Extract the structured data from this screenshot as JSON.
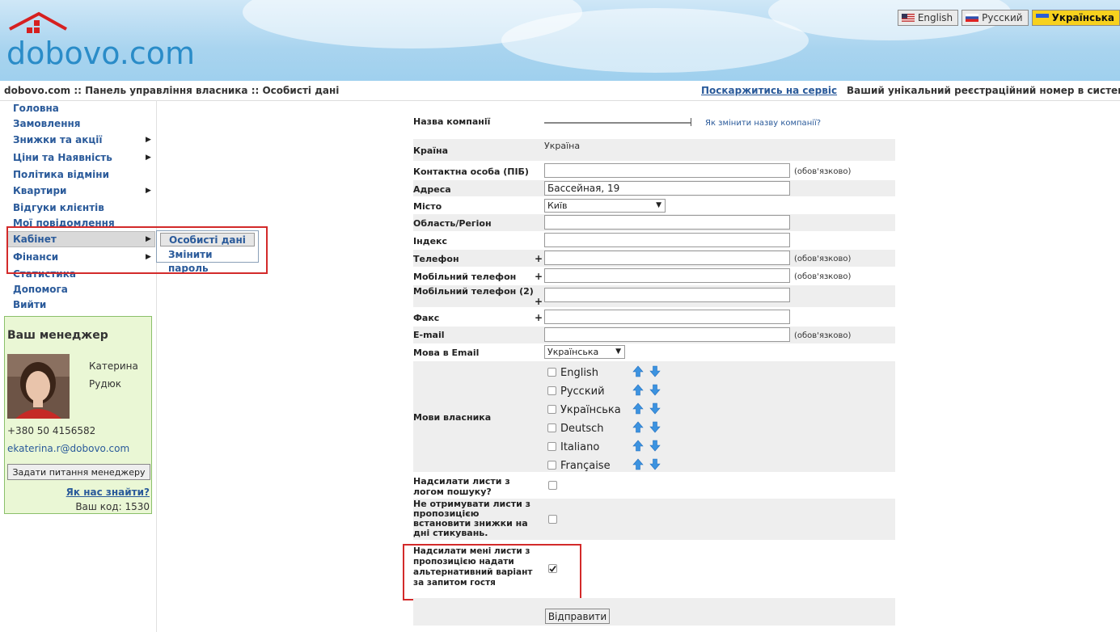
{
  "brand": {
    "logo_text": "dobovo.com",
    "logo_colors": {
      "house": "#d62020",
      "text": "#2a8cc8"
    }
  },
  "languages": [
    {
      "label": "English",
      "flag": "us-flag-icon",
      "active": false
    },
    {
      "label": "Русский",
      "flag": "ru-flag-icon",
      "active": false
    },
    {
      "label": "Українська",
      "flag": "ua-flag-icon",
      "active": true
    }
  ],
  "breadcrumb": "dobovo.com :: Панель управління власника :: Особисті дані",
  "complain_link": "Поскаржитись на сервіс",
  "registration_text": "Ваший унікальний реєстраційний номер в системі ::",
  "menu": [
    {
      "label": "Головна",
      "has_submenu": false
    },
    {
      "label": "Замовлення",
      "has_submenu": false
    },
    {
      "label": "Знижки та акції",
      "has_submenu": true
    },
    {
      "label": "Ціни та Наявність",
      "has_submenu": true
    },
    {
      "label": "Політика відміни",
      "has_submenu": false
    },
    {
      "label": "Квартири",
      "has_submenu": true
    },
    {
      "label": "Відгуки клієнтів",
      "has_submenu": false
    },
    {
      "label": "Мої повідомлення",
      "has_submenu": false
    },
    {
      "label": "Кабінет",
      "has_submenu": true
    },
    {
      "label": "Фінанси",
      "has_submenu": true
    },
    {
      "label": "Статистика",
      "has_submenu": false
    },
    {
      "label": "Допомога",
      "has_submenu": false
    },
    {
      "label": "Вийти",
      "has_submenu": false
    }
  ],
  "submenu": [
    {
      "label": "Особисті дані"
    },
    {
      "label": "Змінити пароль"
    }
  ],
  "manager": {
    "title": "Ваш менеджер",
    "first_name": "Катерина",
    "last_name": "Рудюк",
    "phone": "+380 50 4156582",
    "email": "ekaterina.r@dobovo.com",
    "ask_button": "Задати питання менеджеру",
    "find_link": "Як нас знайти?",
    "code_text": "Ваш код: 1530"
  },
  "form": {
    "company_label": "Назва компанії",
    "company_change_link": "Як змінити назву компанії?",
    "country_label": "Країна",
    "country_value": "Україна",
    "contact_label": "Контактна особа (ПІБ)",
    "required_text": "(обов'язково)",
    "address_label": "Адреса",
    "address_value": "Бассейная, 19",
    "city_label": "Місто",
    "city_value": "Київ",
    "region_label": "Область/Регіон",
    "index_label": "Індекс",
    "phone_label": "Телефон",
    "mobile_label": "Мобільний телефон",
    "mobile2_label": "Мобільний телефон (2)",
    "fax_label": "Факс",
    "email_label": "E-mail",
    "email_lang_label": "Мова в Email",
    "email_lang_value": "Українська",
    "owner_langs_label": "Мови власника",
    "owner_langs": [
      "English",
      "Русский",
      "Українська",
      "Deutsch",
      "Italiano",
      "Française"
    ],
    "send_search_label": "Надсилати листи з логом пошуку?",
    "no_discount_label": "Не отримувати листи з пропозицією встановити знижки на дні стикувань.",
    "alt_variant_label": "Надсилати мені листи з пропозицією надати альтернативний варіант за запитом гостя",
    "alt_variant_checked": true,
    "submit_button": "Відправити",
    "plus_sign": "+"
  }
}
